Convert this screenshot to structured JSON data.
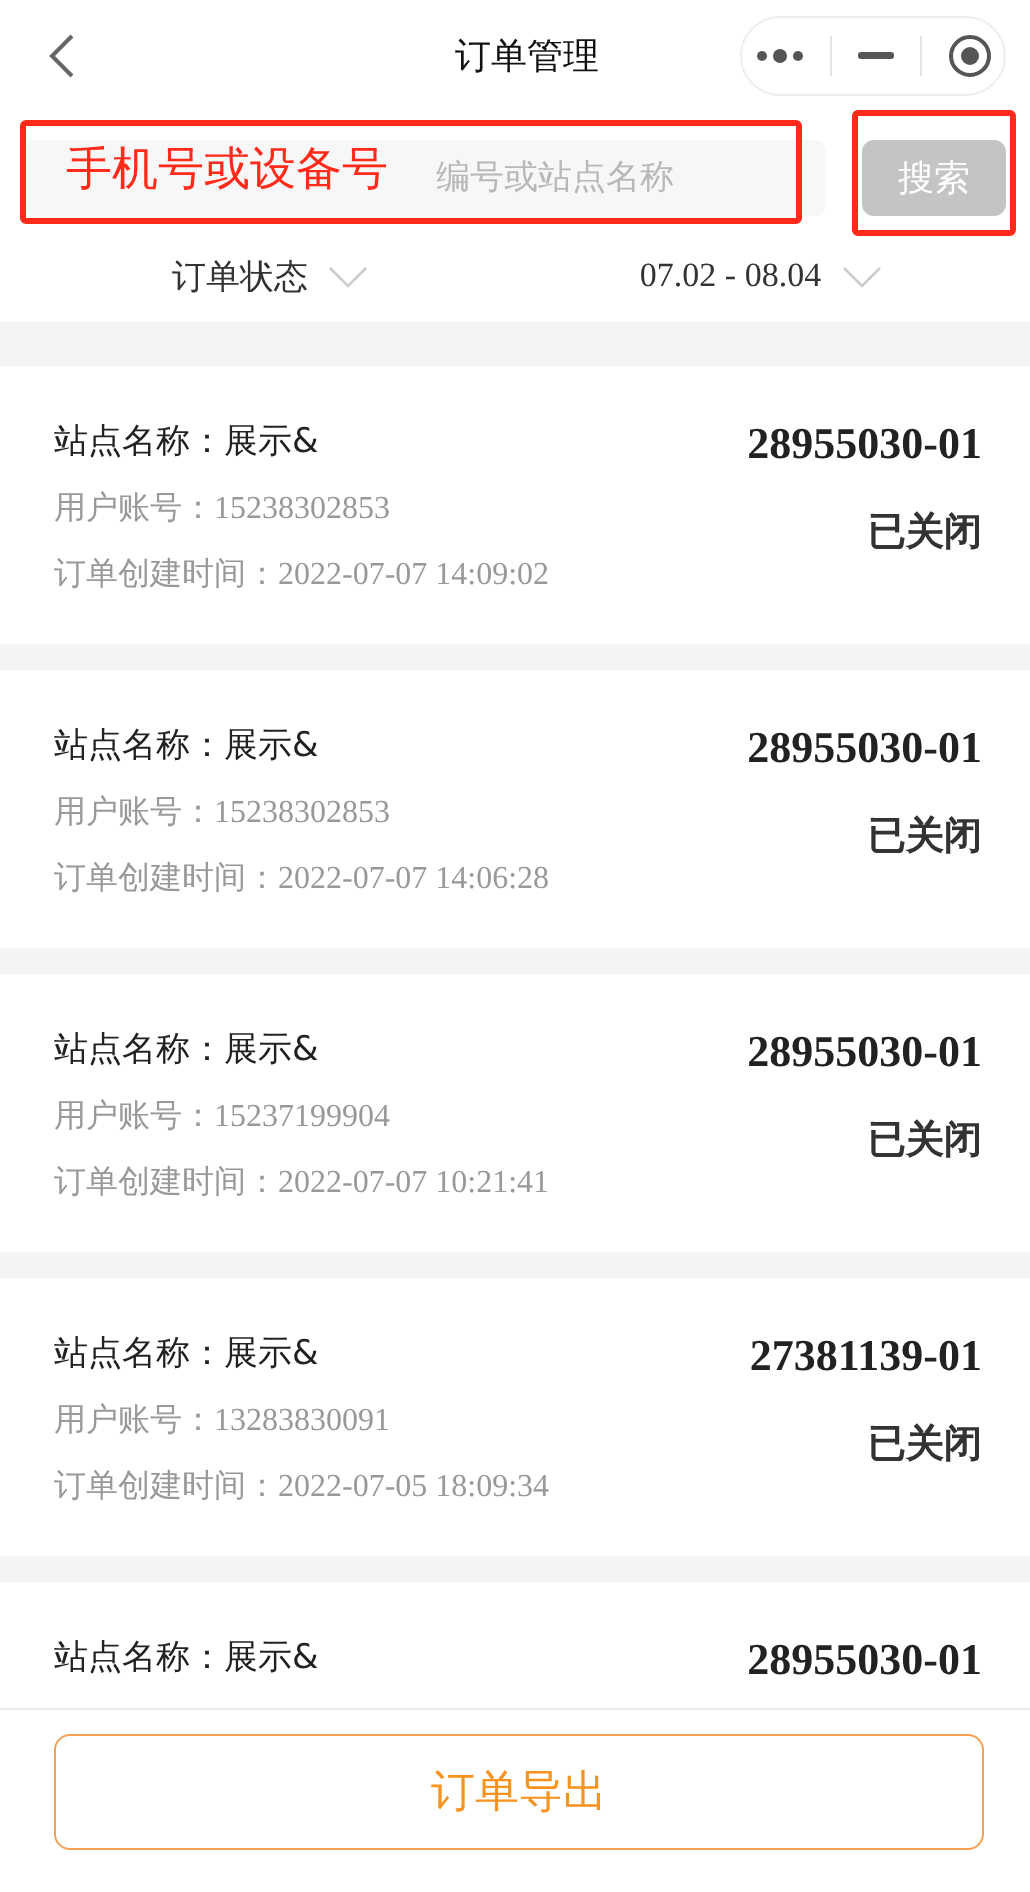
{
  "nav": {
    "title": "订单管理"
  },
  "search": {
    "placeholder": "编号或站点名称",
    "button": "搜索"
  },
  "annotation": {
    "text": "手机号或设备号"
  },
  "filters": [
    {
      "label": "订单状态"
    },
    {
      "label": "07.02 - 08.04"
    }
  ],
  "orders": [
    {
      "station": "站点名称：展示&",
      "number": "28955030-01",
      "account": "用户账号：15238302853",
      "created": "订单创建时间：2022-07-07 14:09:02",
      "status": "已关闭"
    },
    {
      "station": "站点名称：展示&",
      "number": "28955030-01",
      "account": "用户账号：15238302853",
      "created": "订单创建时间：2022-07-07 14:06:28",
      "status": "已关闭"
    },
    {
      "station": "站点名称：展示&",
      "number": "28955030-01",
      "account": "用户账号：15237199904",
      "created": "订单创建时间：2022-07-07 10:21:41",
      "status": "已关闭"
    },
    {
      "station": "站点名称：展示&",
      "number": "27381139-01",
      "account": "用户账号：13283830091",
      "created": "订单创建时间：2022-07-05 18:09:34",
      "status": "已关闭"
    },
    {
      "station": "站点名称：展示&",
      "number": "28955030-01"
    }
  ],
  "export_button": "订单导出"
}
